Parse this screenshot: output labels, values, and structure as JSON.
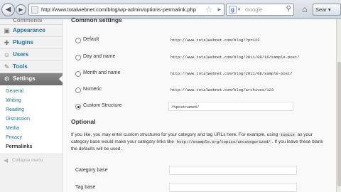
{
  "browser": {
    "back_glyph": "◀",
    "forward_glyph": "▶",
    "url": "http://www.totalwebnet.com/blog/wp-admin/options-permalink.php",
    "star_glyph": "☆",
    "go_glyph": "▸",
    "search_engine_glyph": "g",
    "search_placeholder": "Google",
    "search_glyph": "⚲",
    "home_glyph": "⌂",
    "right_button_label": "Sear ▾"
  },
  "sidebar": {
    "cut_item": "Comments",
    "items": [
      {
        "label": "Appearance",
        "icon": "appearance-icon",
        "glyph": "▣"
      },
      {
        "label": "Plugins",
        "icon": "plugins-icon",
        "glyph": "✚"
      },
      {
        "label": "Users",
        "icon": "users-icon",
        "glyph": "☺"
      },
      {
        "label": "Tools",
        "icon": "tools-icon",
        "glyph": "✎"
      }
    ],
    "settings": {
      "label": "Settings",
      "glyph": "⚙"
    },
    "submenu": [
      "General",
      "Writing",
      "Reading",
      "Discussion",
      "Media",
      "Privacy",
      "Permalinks"
    ],
    "submenu_current": "Permalinks",
    "collapse_label": "Collapse menu",
    "collapse_glyph": "◀"
  },
  "main": {
    "common_title": "Common settings",
    "options": [
      {
        "label": "Default",
        "code": "http://www.totalwebnet.com/blog/?p=123",
        "checked": false
      },
      {
        "label": "Day and name",
        "code": "http://www.totalwebnet.com/blog/2011/08/16/sample-post/",
        "checked": false
      },
      {
        "label": "Month and name",
        "code": "http://www.totalwebnet.com/blog/2011/08/sample-post/",
        "checked": false
      },
      {
        "label": "Numeric",
        "code": "http://www.totalwebnet.com/blog/archives/123",
        "checked": false
      },
      {
        "label": "Custom Structure",
        "value": "/%postname%/",
        "checked": true
      }
    ],
    "optional_title": "Optional",
    "help_text_1": "If you like, you may enter custom structures for your category and tag URLs here. For example, using",
    "help_code_1": "topics",
    "help_text_2": "as your category base would make your category links like",
    "help_code_2": "http://example.org/topics/uncategorized/",
    "help_text_3": ". If you leave these blank the defaults will be used.",
    "category_base_label": "Category base",
    "tag_base_label": "Tag base"
  }
}
